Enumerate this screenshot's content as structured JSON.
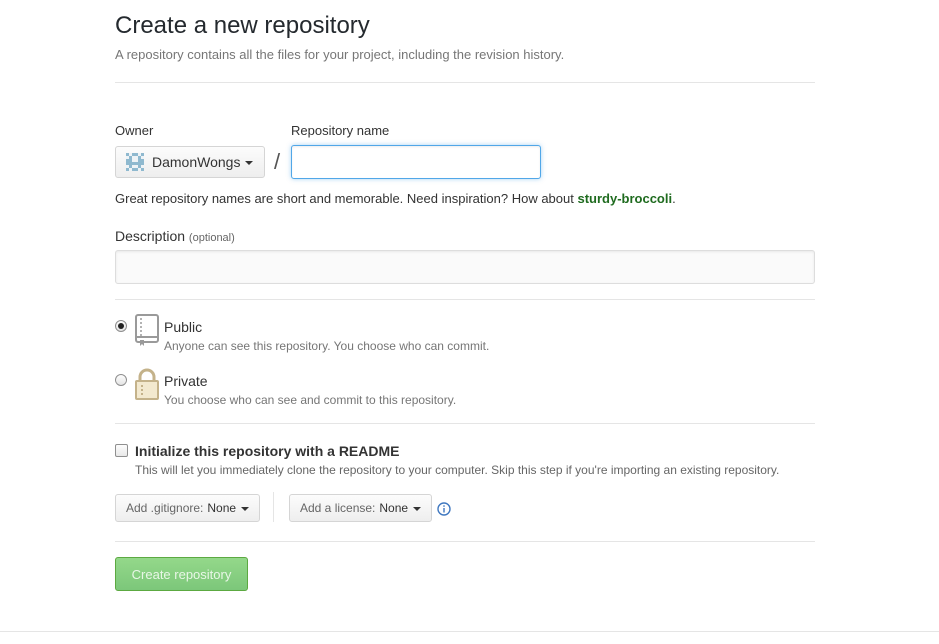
{
  "header": {
    "title": "Create a new repository",
    "subtitle": "A repository contains all the files for your project, including the revision history."
  },
  "owner": {
    "label": "Owner",
    "value": "DamonWongs"
  },
  "repo_name": {
    "label": "Repository name",
    "value": "",
    "separator": "/"
  },
  "hint": {
    "text": "Great repository names are short and memorable. Need inspiration? How about ",
    "suggestion": "sturdy-broccoli",
    "end": "."
  },
  "description": {
    "label": "Description",
    "optional": "(optional)",
    "value": ""
  },
  "visibility": {
    "public": {
      "title": "Public",
      "note": "Anyone can see this repository. You choose who can commit.",
      "checked": true
    },
    "private": {
      "title": "Private",
      "note": "You choose who can see and commit to this repository.",
      "checked": false
    }
  },
  "readme": {
    "title": "Initialize this repository with a README",
    "note": "This will let you immediately clone the repository to your computer. Skip this step if you're importing an existing repository.",
    "checked": false
  },
  "gitignore": {
    "label": "Add .gitignore:",
    "value": "None"
  },
  "license": {
    "label": "Add a license:",
    "value": "None"
  },
  "submit": {
    "label": "Create repository"
  },
  "colors": {
    "suggestion": "#1f6b1f",
    "focus": "#51a7e8",
    "create_button": "#8dd08d",
    "info_icon": "#4078c0"
  }
}
